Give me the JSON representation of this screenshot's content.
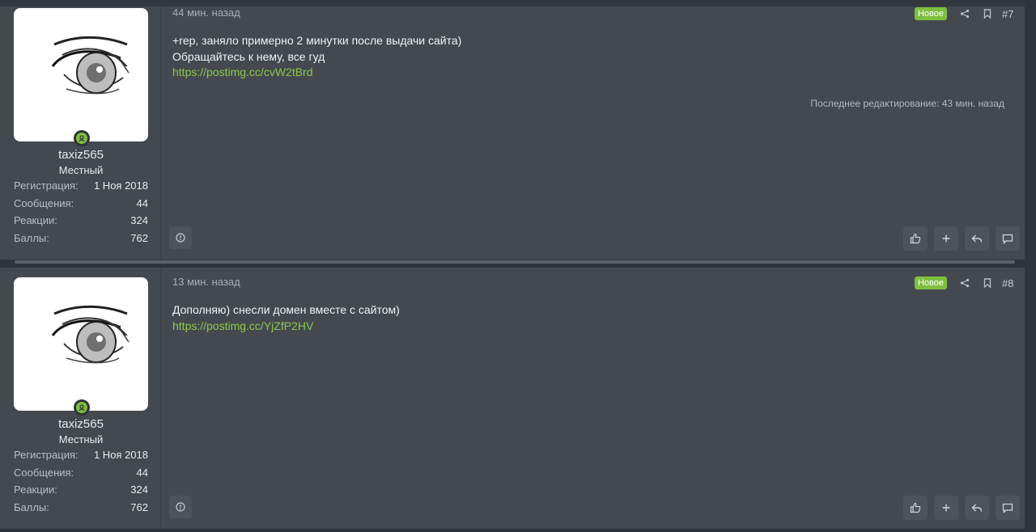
{
  "posts": [
    {
      "time": "44 мин. назад",
      "badge": "Новое",
      "number": "#7",
      "message_lines": [
        "+rep, заняло примерно 2 минутки после выдачи сайта)",
        "Обращайтесь к нему, все гуд"
      ],
      "link": "https://postimg.cc/cvW2tBrd",
      "edited": "Последнее редактирование: 43 мин. назад",
      "user": {
        "name": "taxiz565",
        "title": "Местный",
        "stats": [
          {
            "label": "Регистрация:",
            "value": "1 Ноя 2018"
          },
          {
            "label": "Сообщения:",
            "value": "44"
          },
          {
            "label": "Реакции:",
            "value": "324"
          },
          {
            "label": "Баллы:",
            "value": "762"
          }
        ]
      }
    },
    {
      "time": "13 мин. назад",
      "badge": "Новое",
      "number": "#8",
      "message_lines": [
        "Дополняю) снесли домен вместе с сайтом)"
      ],
      "link": "https://postimg.cc/YjZfP2HV",
      "edited": "",
      "user": {
        "name": "taxiz565",
        "title": "Местный",
        "stats": [
          {
            "label": "Регистрация:",
            "value": "1 Ноя 2018"
          },
          {
            "label": "Сообщения:",
            "value": "44"
          },
          {
            "label": "Реакции:",
            "value": "324"
          },
          {
            "label": "Баллы:",
            "value": "762"
          }
        ]
      }
    }
  ],
  "icons": {
    "online": "online-status-icon",
    "share": "share-icon",
    "bookmark": "bookmark-icon",
    "report": "report-icon",
    "like": "thumbs-up-icon",
    "add": "plus-icon",
    "reply": "reply-icon",
    "quote": "comment-icon"
  },
  "colors": {
    "accent": "#7fbf3f",
    "link": "#8cc84b",
    "post_bg": "#44494f",
    "page_bg": "#2f343a"
  }
}
